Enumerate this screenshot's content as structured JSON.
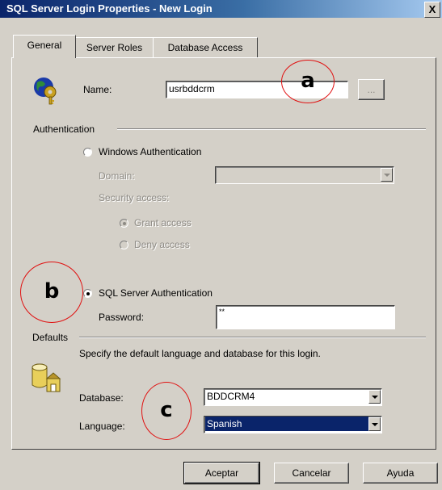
{
  "window": {
    "title": "SQL Server Login Properties - New Login",
    "close_glyph": "X"
  },
  "tabs": [
    {
      "label": "General",
      "active": true
    },
    {
      "label": "Server Roles",
      "active": false
    },
    {
      "label": "Database Access",
      "active": false
    }
  ],
  "general": {
    "name_label": "Name:",
    "name_value": "usrbddcrm",
    "browse_label": "...",
    "authentication_label": "Authentication",
    "windows_auth_label": "Windows Authentication",
    "domain_label": "Domain:",
    "security_access_label": "Security access:",
    "grant_access_label": "Grant access",
    "deny_access_label": "Deny access",
    "sql_auth_label": "SQL Server Authentication",
    "password_label": "Password:",
    "password_value": "**",
    "selected_auth": "SQL Server Authentication"
  },
  "defaults": {
    "section_label": "Defaults",
    "description": "Specify the default language and database for this login.",
    "database_label": "Database:",
    "database_value": "BDDCRM4",
    "language_label": "Language:",
    "language_value": "Spanish"
  },
  "buttons": {
    "ok": "Aceptar",
    "cancel": "Cancelar",
    "help": "Ayuda"
  },
  "annotations": {
    "a": "a",
    "b": "b",
    "c": "c",
    "circle_color": "#e01010"
  },
  "icons": {
    "login": "globe-key-icon",
    "defaults": "database-icon"
  }
}
